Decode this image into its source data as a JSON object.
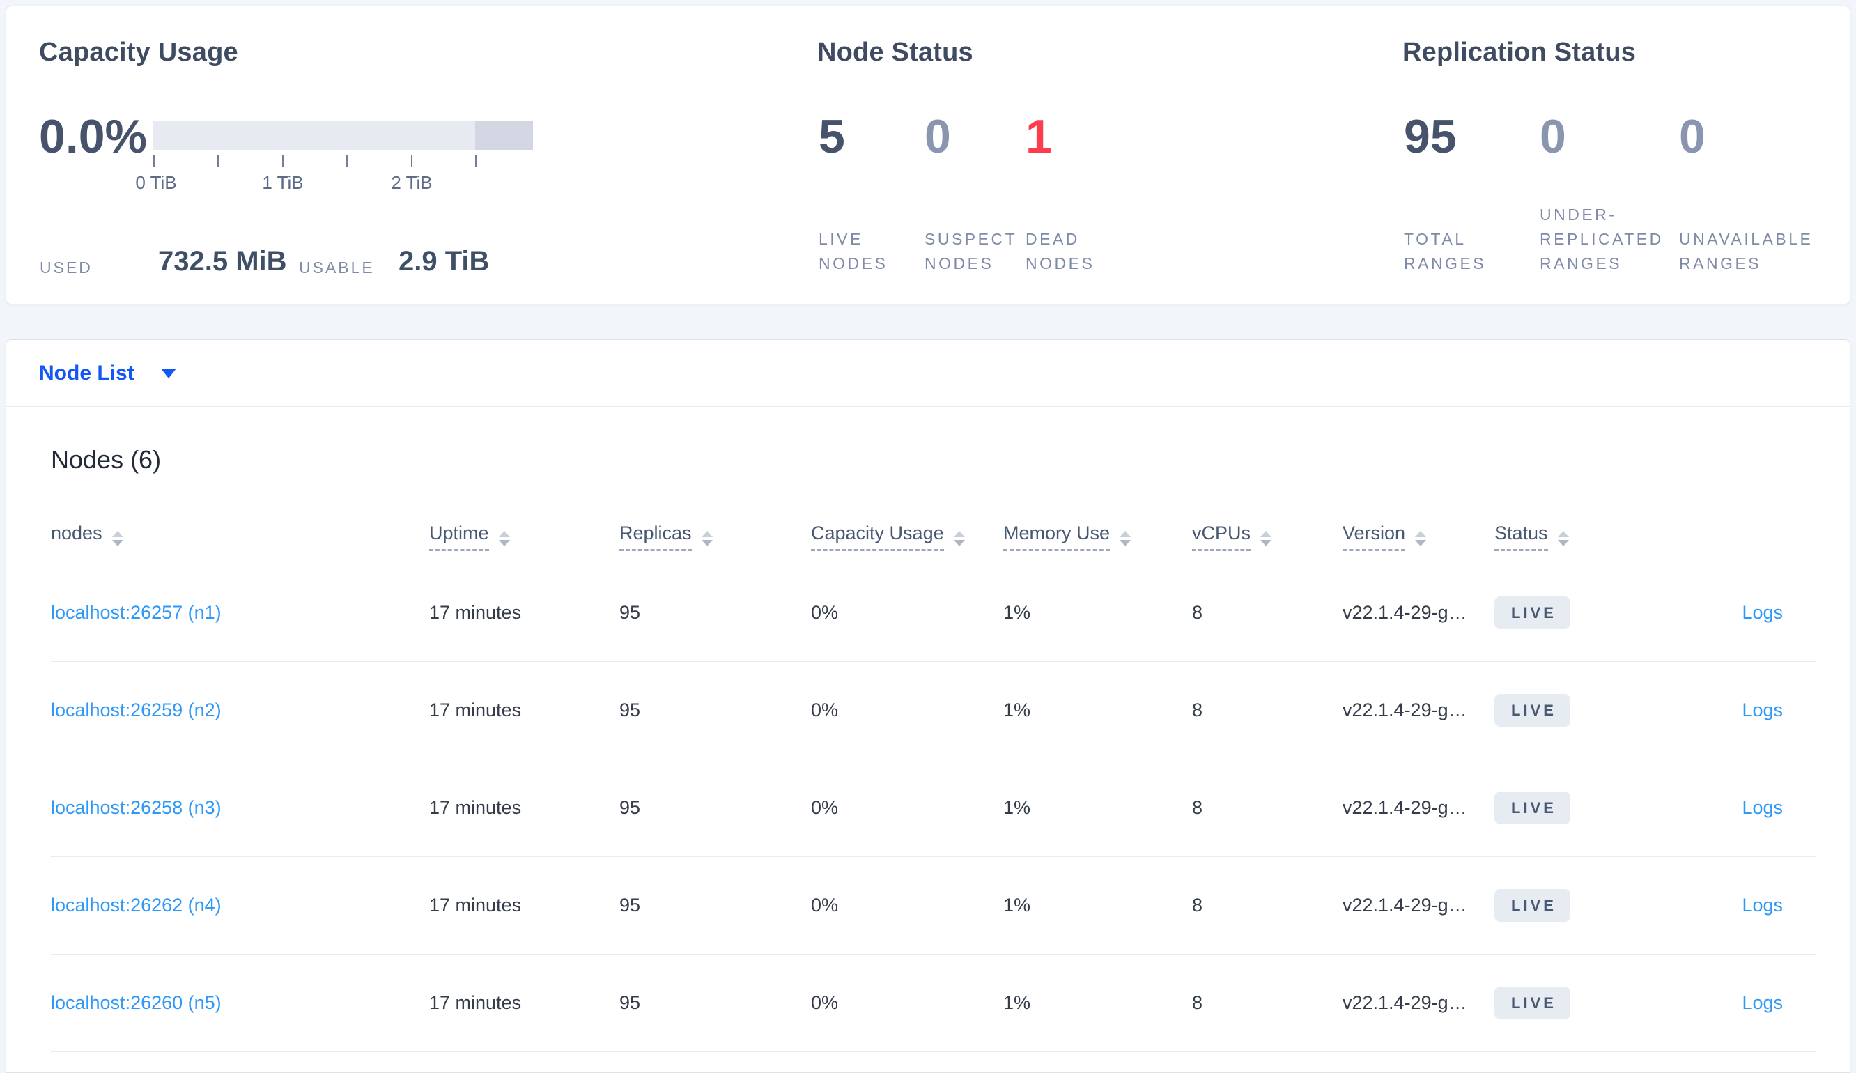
{
  "colors": {
    "page_bg": "#f2f5f9",
    "accent_blue": "#1357f5",
    "link_blue": "#2e98f7",
    "danger_red": "#fc3d4e",
    "stat_dark": "#46536b",
    "stat_muted": "#8a95b0",
    "bar_track": "#e8eaf1",
    "bar_tail": "#d3d7e3",
    "badge_bg": "#e7ecf3"
  },
  "summary": {
    "capacity": {
      "title": "Capacity Usage",
      "percent": "0.0%",
      "ticks": [
        "0 TiB",
        "1 TiB",
        "2 TiB"
      ],
      "used_label": "USED",
      "used_value": "732.5 MiB",
      "usable_label": "USABLE",
      "usable_value": "2.9 TiB"
    },
    "node_status": {
      "title": "Node Status",
      "stats": [
        {
          "value": "5",
          "tone": "dark",
          "label_lines": [
            "LIVE",
            "NODES"
          ]
        },
        {
          "value": "0",
          "tone": "muted",
          "label_lines": [
            "SUSPECT",
            "NODES"
          ]
        },
        {
          "value": "1",
          "tone": "danger",
          "label_lines": [
            "DEAD",
            "NODES"
          ]
        }
      ]
    },
    "replication_status": {
      "title": "Replication Status",
      "stats": [
        {
          "value": "95",
          "tone": "dark",
          "label_lines": [
            "TOTAL",
            "RANGES"
          ]
        },
        {
          "value": "0",
          "tone": "muted",
          "label_lines": [
            "UNDER-",
            "REPLICATED",
            "RANGES"
          ]
        },
        {
          "value": "0",
          "tone": "muted",
          "label_lines": [
            "UNAVAILABLE",
            "RANGES"
          ]
        }
      ]
    }
  },
  "node_list": {
    "dropdown_label": "Node List",
    "heading": "Nodes (6)",
    "columns": [
      {
        "label": "nodes"
      },
      {
        "label": "Uptime"
      },
      {
        "label": "Replicas"
      },
      {
        "label": "Capacity Usage"
      },
      {
        "label": "Memory Use"
      },
      {
        "label": "vCPUs"
      },
      {
        "label": "Version"
      },
      {
        "label": "Status"
      }
    ],
    "rows": [
      {
        "node": "localhost:26257 (n1)",
        "uptime": "17 minutes",
        "replicas": "95",
        "capacity": "0%",
        "memory": "1%",
        "vcpus": "8",
        "version": "v22.1.4-29-g…",
        "status": "LIVE",
        "logs": "Logs"
      },
      {
        "node": "localhost:26259 (n2)",
        "uptime": "17 minutes",
        "replicas": "95",
        "capacity": "0%",
        "memory": "1%",
        "vcpus": "8",
        "version": "v22.1.4-29-g…",
        "status": "LIVE",
        "logs": "Logs"
      },
      {
        "node": "localhost:26258 (n3)",
        "uptime": "17 minutes",
        "replicas": "95",
        "capacity": "0%",
        "memory": "1%",
        "vcpus": "8",
        "version": "v22.1.4-29-g…",
        "status": "LIVE",
        "logs": "Logs"
      },
      {
        "node": "localhost:26262 (n4)",
        "uptime": "17 minutes",
        "replicas": "95",
        "capacity": "0%",
        "memory": "1%",
        "vcpus": "8",
        "version": "v22.1.4-29-g…",
        "status": "LIVE",
        "logs": "Logs"
      },
      {
        "node": "localhost:26260 (n5)",
        "uptime": "17 minutes",
        "replicas": "95",
        "capacity": "0%",
        "memory": "1%",
        "vcpus": "8",
        "version": "v22.1.4-29-g…",
        "status": "LIVE",
        "logs": "Logs"
      }
    ]
  }
}
